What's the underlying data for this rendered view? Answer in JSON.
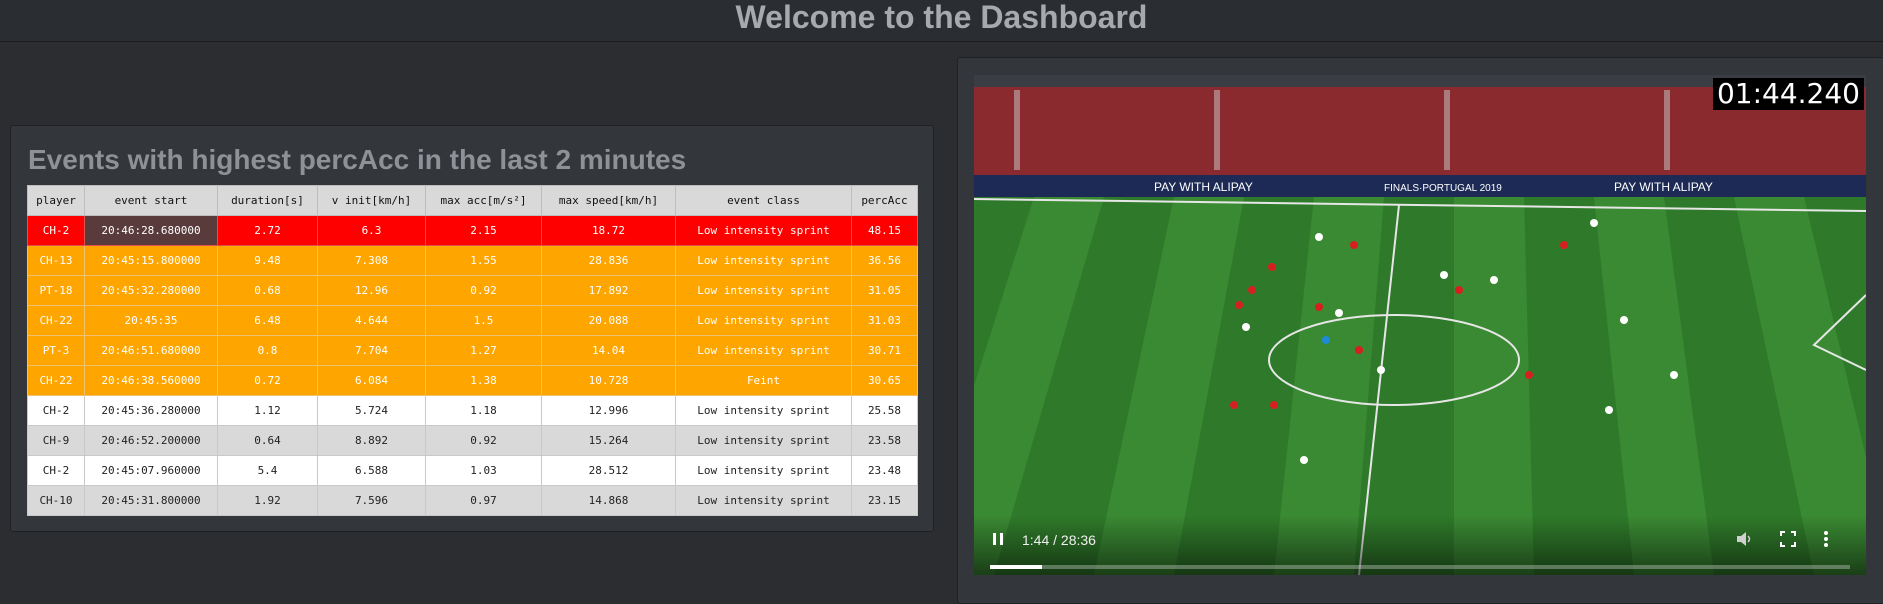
{
  "header": {
    "title": "Welcome to the Dashboard"
  },
  "events_table": {
    "title": "Events with highest percAcc in the last 2 minutes",
    "columns": [
      "player",
      "event start",
      "duration[s]",
      "v init[km/h]",
      "max acc[m/s²]",
      "max speed[km/h]",
      "event class",
      "percAcc"
    ],
    "rows": [
      {
        "status": "red",
        "cells": [
          "CH-2",
          "20:46:28.680000",
          "2.72",
          "6.3",
          "2.15",
          "18.72",
          "Low intensity sprint",
          "48.15"
        ]
      },
      {
        "status": "orange",
        "cells": [
          "CH-13",
          "20:45:15.800000",
          "9.48",
          "7.308",
          "1.55",
          "28.836",
          "Low intensity sprint",
          "36.56"
        ]
      },
      {
        "status": "orange",
        "cells": [
          "PT-18",
          "20:45:32.280000",
          "0.68",
          "12.96",
          "0.92",
          "17.892",
          "Low intensity sprint",
          "31.05"
        ]
      },
      {
        "status": "orange",
        "cells": [
          "CH-22",
          "20:45:35",
          "6.48",
          "4.644",
          "1.5",
          "20.088",
          "Low intensity sprint",
          "31.03"
        ]
      },
      {
        "status": "orange",
        "cells": [
          "PT-3",
          "20:46:51.680000",
          "0.8",
          "7.704",
          "1.27",
          "14.04",
          "Low intensity sprint",
          "30.71"
        ]
      },
      {
        "status": "orange",
        "cells": [
          "CH-22",
          "20:46:38.560000",
          "0.72",
          "6.084",
          "1.38",
          "10.728",
          "Feint",
          "30.65"
        ]
      },
      {
        "status": "white",
        "cells": [
          "CH-2",
          "20:45:36.280000",
          "1.12",
          "5.724",
          "1.18",
          "12.996",
          "Low intensity sprint",
          "25.58"
        ]
      },
      {
        "status": "grey",
        "cells": [
          "CH-9",
          "20:46:52.200000",
          "0.64",
          "8.892",
          "0.92",
          "15.264",
          "Low intensity sprint",
          "23.58"
        ]
      },
      {
        "status": "white",
        "cells": [
          "CH-2",
          "20:45:07.960000",
          "5.4",
          "6.588",
          "1.03",
          "28.512",
          "Low intensity sprint",
          "23.48"
        ]
      },
      {
        "status": "grey",
        "cells": [
          "CH-10",
          "20:45:31.800000",
          "1.92",
          "7.596",
          "0.97",
          "14.868",
          "Low intensity sprint",
          "23.15"
        ]
      }
    ],
    "colors": {
      "red": "#ff0000",
      "orange": "#ffa500",
      "white": "#ffffff",
      "grey": "#d9d9d9"
    }
  },
  "video": {
    "timestamp_overlay": "01:44.240",
    "time_display": "1:44 / 28:36",
    "progress": 0.061,
    "banner_texts": [
      "PAY WITH ALIPAY",
      "FINALS·PORTUGAL 2019",
      "PAY WITH ALIPAY"
    ],
    "icons": {
      "play": "pause-icon",
      "mute": "volume-icon",
      "fullscreen": "fullscreen-icon",
      "more": "more-vert-icon"
    }
  }
}
